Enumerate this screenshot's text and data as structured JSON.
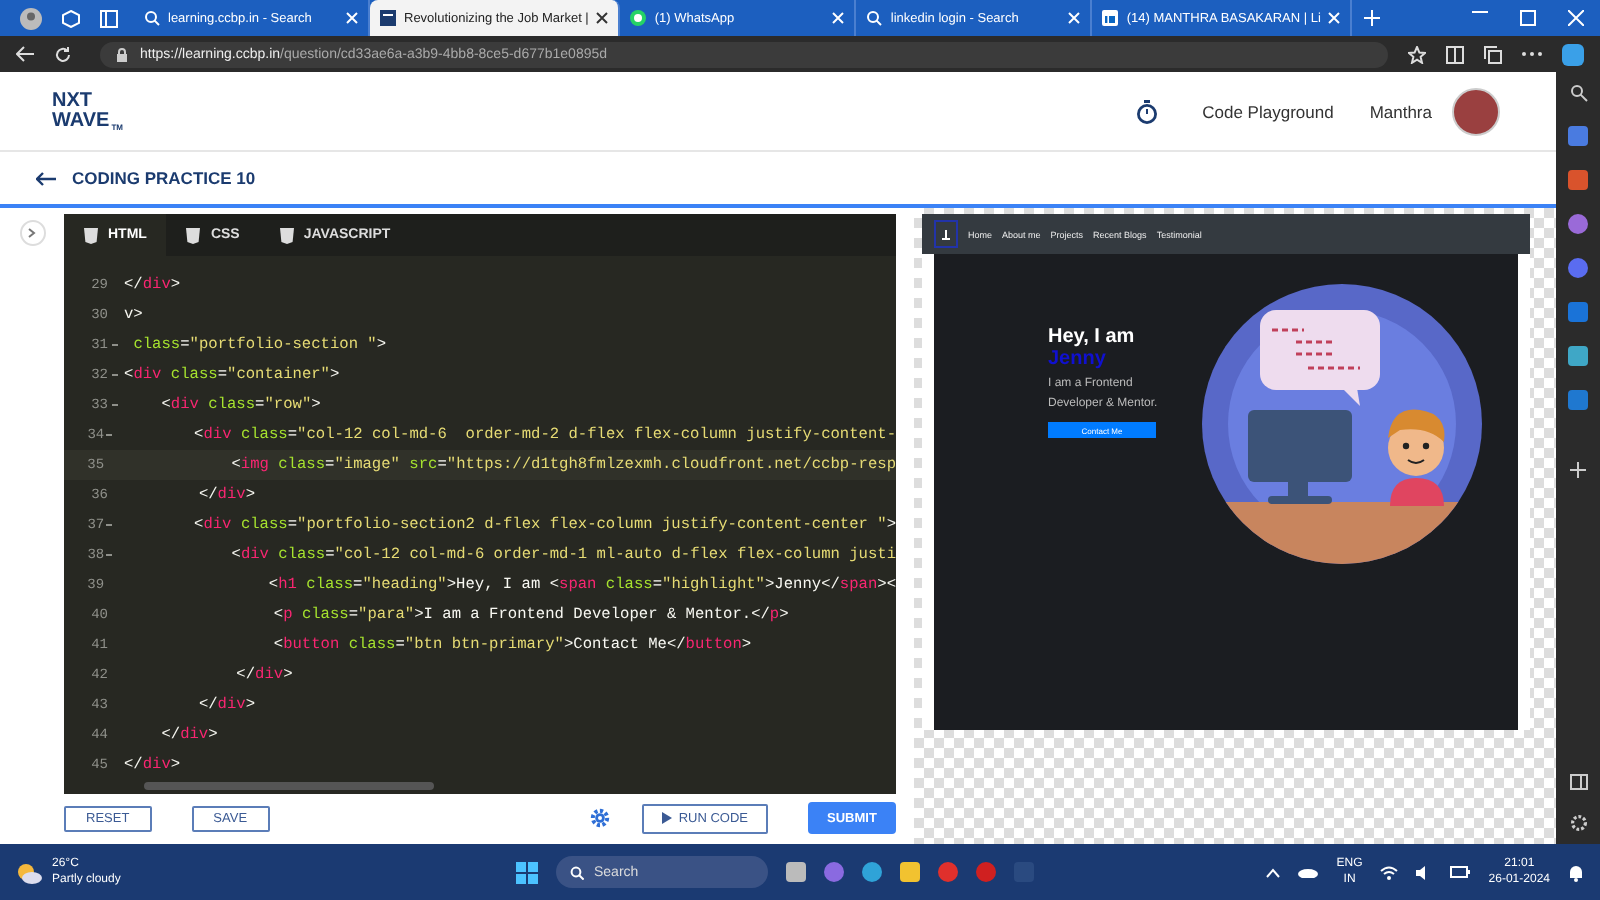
{
  "browser": {
    "tabs": [
      {
        "title": "learning.ccbp.in - Search",
        "kind": "search",
        "selected": false
      },
      {
        "title": "Revolutionizing the Job Market |",
        "kind": "page",
        "selected": true
      },
      {
        "title": "(1) WhatsApp",
        "kind": "whatsapp",
        "selected": false
      },
      {
        "title": "linkedin login - Search",
        "kind": "search",
        "selected": false
      },
      {
        "title": "(14) MANTHRA BASAKARAN | Li",
        "kind": "linkedin",
        "selected": false
      }
    ],
    "url_host": "https://learning.ccbp.in",
    "url_path": "/question/cd33ae6a-a3b9-4bb8-8ce5-d677b1e0895d"
  },
  "header": {
    "logo_top": "NXT",
    "logo_bottom": "WAVE",
    "logo_mark": "TM",
    "playground_link": "Code Playground",
    "user_name": "Manthra"
  },
  "page_title": "CODING PRACTICE 10",
  "editor": {
    "tabs": [
      {
        "label": "HTML",
        "selected": true
      },
      {
        "label": "CSS",
        "selected": false
      },
      {
        "label": "JAVASCRIPT",
        "selected": false
      }
    ],
    "lines": [
      {
        "number": "29",
        "text": "</div>",
        "fold": false,
        "active": false
      },
      {
        "number": "30",
        "text": "v>",
        "fold": false,
        "active": false
      },
      {
        "number": "31",
        "text": " class=\"portfolio-section \">",
        "fold": true,
        "active": false
      },
      {
        "number": "32",
        "text": "<div class=\"container\">",
        "fold": true,
        "active": false
      },
      {
        "number": "33",
        "text": "    <div class=\"row\">",
        "fold": true,
        "active": false
      },
      {
        "number": "34",
        "text": "        <div class=\"col-12 col-md-6  order-md-2 d-flex flex-column justify-content-",
        "fold": true,
        "active": false
      },
      {
        "number": "35",
        "text": "            <img class=\"image\" src=\"https://d1tgh8fmlzexmh.cloudfront.net/ccbp-resp",
        "fold": false,
        "active": true
      },
      {
        "number": "36",
        "text": "        </div>",
        "fold": false,
        "active": false
      },
      {
        "number": "37",
        "text": "        <div class=\"portfolio-section2 d-flex flex-column justify-content-center \">",
        "fold": true,
        "active": false
      },
      {
        "number": "38",
        "text": "            <div class=\"col-12 col-md-6 order-md-1 ml-auto d-flex flex-column justi",
        "fold": true,
        "active": false
      },
      {
        "number": "39",
        "text": "                <h1 class=\"heading\">Hey, I am <span class=\"highlight\">Jenny</span><",
        "fold": false,
        "active": false
      },
      {
        "number": "40",
        "text": "                <p class=\"para\">I am a Frontend Developer & Mentor.</p>",
        "fold": false,
        "active": false
      },
      {
        "number": "41",
        "text": "                <button class=\"btn btn-primary\">Contact Me</button>",
        "fold": false,
        "active": false
      },
      {
        "number": "42",
        "text": "            </div>",
        "fold": false,
        "active": false
      },
      {
        "number": "43",
        "text": "        </div>",
        "fold": false,
        "active": false
      },
      {
        "number": "44",
        "text": "    </div>",
        "fold": false,
        "active": false
      },
      {
        "number": "45",
        "text": "</div>",
        "fold": false,
        "active": false
      }
    ],
    "buttons": [
      {
        "label": "RESET",
        "kind": "outline"
      },
      {
        "label": "SAVE",
        "kind": "outline"
      },
      {
        "kind": "settings"
      },
      {
        "label": "RUN CODE",
        "kind": "run"
      },
      {
        "label": "SUBMIT",
        "kind": "primary"
      }
    ]
  },
  "preview": {
    "nav_links": [
      "Home",
      "About me",
      "Projects",
      "Recent Blogs",
      "Testimonial"
    ],
    "heading": "Hey, I am",
    "highlight": "Jenny",
    "para": "I am a Frontend Developer & Mentor.",
    "button": "Contact Me"
  },
  "taskbar": {
    "temperature": "26°C",
    "weather": "Partly cloudy",
    "search_placeholder": "Search",
    "language": "ENG",
    "region": "IN",
    "time": "21:01",
    "date": "26-01-2024"
  }
}
